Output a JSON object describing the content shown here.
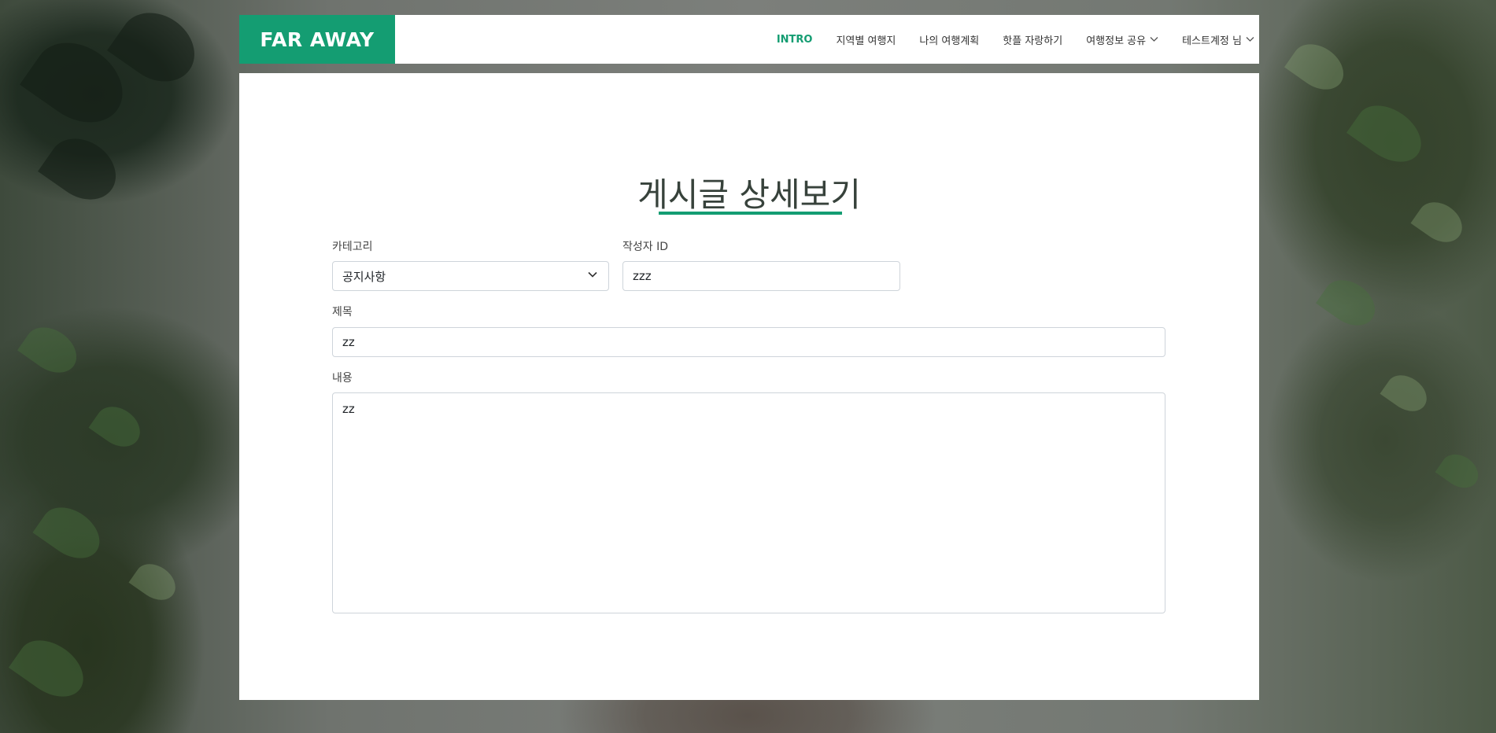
{
  "header": {
    "brand": "FAR AWAY",
    "nav": [
      {
        "label": "INTRO",
        "active": true
      },
      {
        "label": "지역별 여행지"
      },
      {
        "label": "나의 여행계획"
      },
      {
        "label": "핫플 자랑하기"
      },
      {
        "label": "여행정보 공유",
        "dropdown": true
      },
      {
        "label": "테스트계정 님",
        "dropdown": true
      }
    ]
  },
  "page": {
    "title": "게시글 상세보기"
  },
  "form": {
    "category_label": "카테고리",
    "category_value": "공지사항",
    "author_label": "작성자 ID",
    "author_value": "zzz",
    "subject_label": "제목",
    "subject_value": "zz",
    "content_label": "내용",
    "content_value": "zz"
  },
  "colors": {
    "accent": "#149d72"
  },
  "icons": {
    "dropdown": "chevron-down-icon"
  }
}
